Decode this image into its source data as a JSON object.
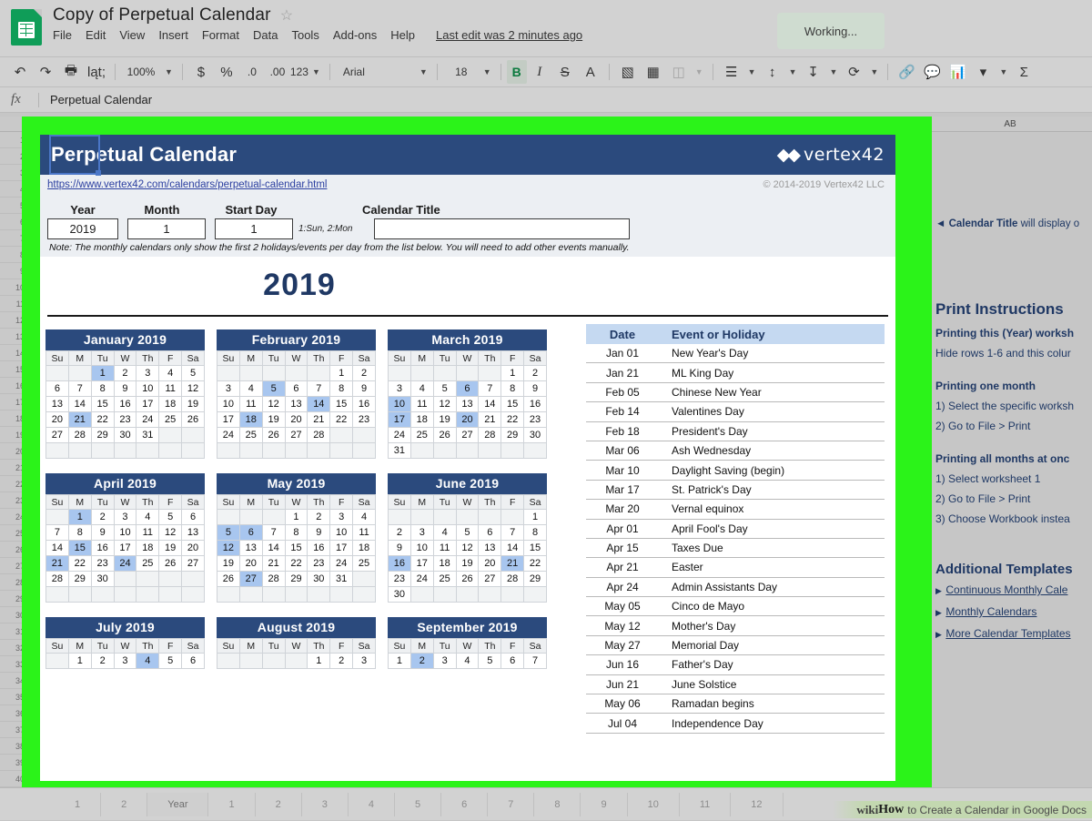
{
  "app": {
    "doc_title": "Copy of Perpetual Calendar",
    "star_icon": "star-outline-icon",
    "menu": [
      "File",
      "Edit",
      "View",
      "Insert",
      "Format",
      "Data",
      "Tools",
      "Add-ons",
      "Help"
    ],
    "last_edit": "Last edit was 2 minutes ago",
    "working_status": "Working..."
  },
  "toolbar": {
    "undo_icon": "undo-icon",
    "redo_icon": "redo-icon",
    "print_icon": "print-icon",
    "paint_format_icon": "paint-format-icon",
    "zoom": "100%",
    "currency": "$",
    "percent": "%",
    "decrease_decimal": ".0",
    "increase_decimal": ".00",
    "number_format": "123",
    "font": "Arial",
    "font_size": "18",
    "bold": "B",
    "italic": "I",
    "strikethrough": "S",
    "text_color": "A",
    "fill_color_icon": "fill-color-icon",
    "borders_icon": "borders-icon",
    "merge_icon": "merge-cells-icon",
    "halign_icon": "horizontal-align-icon",
    "valign_icon": "vertical-align-icon",
    "wrap_icon": "text-wrap-icon",
    "rotate_icon": "text-rotation-icon",
    "link_icon": "insert-link-icon",
    "comment_icon": "insert-comment-icon",
    "chart_icon": "insert-chart-icon",
    "filter_icon": "filter-icon",
    "functions_icon": "functions-sigma-icon"
  },
  "formula_bar": {
    "fx": "fx",
    "value": "Perpetual Calendar"
  },
  "grid": {
    "visible_column_header": "AB",
    "row_numbers": [
      "1",
      "2",
      "3",
      "4",
      "5",
      "6",
      "7",
      "8",
      "9",
      "10",
      "11",
      "12",
      "13",
      "14",
      "15",
      "16",
      "17",
      "18",
      "19",
      "20",
      "21",
      "22",
      "23",
      "24",
      "25",
      "26",
      "27",
      "28",
      "29",
      "30",
      "31",
      "32",
      "33",
      "34",
      "35",
      "36",
      "37",
      "38",
      "39",
      "40"
    ]
  },
  "sheet": {
    "title": "Perpetual Calendar",
    "logo_text": "vertex42",
    "url": "https://www.vertex42.com/calendars/perpetual-calendar.html",
    "copyright": "© 2014-2019 Vertex42 LLC",
    "fields": [
      {
        "label": "Year",
        "value": "2019"
      },
      {
        "label": "Month",
        "value": "1"
      },
      {
        "label": "Start Day",
        "value": "1"
      },
      {
        "label": "Calendar Title",
        "value": ""
      }
    ],
    "start_day_hint": "1:Sun, 2:Mon",
    "note": "Note: The monthly calendars only show the first 2 holidays/events per day from the list below. You will need to add other events manually.",
    "year_display": "2019"
  },
  "calendar": {
    "weekday_headers": [
      "Su",
      "M",
      "Tu",
      "W",
      "Th",
      "F",
      "Sa"
    ],
    "months": [
      {
        "name": "January 2019",
        "weeks": [
          [
            "",
            "",
            "1",
            "2",
            "3",
            "4",
            "5"
          ],
          [
            "6",
            "7",
            "8",
            "9",
            "10",
            "11",
            "12"
          ],
          [
            "13",
            "14",
            "15",
            "16",
            "17",
            "18",
            "19"
          ],
          [
            "20",
            "21",
            "22",
            "23",
            "24",
            "25",
            "26"
          ],
          [
            "27",
            "28",
            "29",
            "30",
            "31",
            "",
            ""
          ],
          [
            "",
            "",
            "",
            "",
            "",
            "",
            ""
          ]
        ],
        "highlights": [
          "1",
          "21"
        ]
      },
      {
        "name": "February 2019",
        "weeks": [
          [
            "",
            "",
            "",
            "",
            "",
            "1",
            "2"
          ],
          [
            "3",
            "4",
            "5",
            "6",
            "7",
            "8",
            "9"
          ],
          [
            "10",
            "11",
            "12",
            "13",
            "14",
            "15",
            "16"
          ],
          [
            "17",
            "18",
            "19",
            "20",
            "21",
            "22",
            "23"
          ],
          [
            "24",
            "25",
            "26",
            "27",
            "28",
            "",
            ""
          ],
          [
            "",
            "",
            "",
            "",
            "",
            "",
            ""
          ]
        ],
        "highlights": [
          "5",
          "14",
          "18"
        ]
      },
      {
        "name": "March 2019",
        "weeks": [
          [
            "",
            "",
            "",
            "",
            "",
            "1",
            "2"
          ],
          [
            "3",
            "4",
            "5",
            "6",
            "7",
            "8",
            "9"
          ],
          [
            "10",
            "11",
            "12",
            "13",
            "14",
            "15",
            "16"
          ],
          [
            "17",
            "18",
            "19",
            "20",
            "21",
            "22",
            "23"
          ],
          [
            "24",
            "25",
            "26",
            "27",
            "28",
            "29",
            "30"
          ],
          [
            "31",
            "",
            "",
            "",
            "",
            "",
            ""
          ]
        ],
        "highlights": [
          "6",
          "10",
          "17",
          "20"
        ]
      },
      {
        "name": "April 2019",
        "weeks": [
          [
            "",
            "1",
            "2",
            "3",
            "4",
            "5",
            "6"
          ],
          [
            "7",
            "8",
            "9",
            "10",
            "11",
            "12",
            "13"
          ],
          [
            "14",
            "15",
            "16",
            "17",
            "18",
            "19",
            "20"
          ],
          [
            "21",
            "22",
            "23",
            "24",
            "25",
            "26",
            "27"
          ],
          [
            "28",
            "29",
            "30",
            "",
            "",
            "",
            ""
          ],
          [
            "",
            "",
            "",
            "",
            "",
            "",
            ""
          ]
        ],
        "highlights": [
          "1",
          "15",
          "21",
          "24"
        ]
      },
      {
        "name": "May 2019",
        "weeks": [
          [
            "",
            "",
            "",
            "1",
            "2",
            "3",
            "4"
          ],
          [
            "5",
            "6",
            "7",
            "8",
            "9",
            "10",
            "11"
          ],
          [
            "12",
            "13",
            "14",
            "15",
            "16",
            "17",
            "18"
          ],
          [
            "19",
            "20",
            "21",
            "22",
            "23",
            "24",
            "25"
          ],
          [
            "26",
            "27",
            "28",
            "29",
            "30",
            "31",
            ""
          ],
          [
            "",
            "",
            "",
            "",
            "",
            "",
            ""
          ]
        ],
        "highlights": [
          "5",
          "6",
          "12",
          "27"
        ]
      },
      {
        "name": "June 2019",
        "weeks": [
          [
            "",
            "",
            "",
            "",
            "",
            "",
            "1"
          ],
          [
            "2",
            "3",
            "4",
            "5",
            "6",
            "7",
            "8"
          ],
          [
            "9",
            "10",
            "11",
            "12",
            "13",
            "14",
            "15"
          ],
          [
            "16",
            "17",
            "18",
            "19",
            "20",
            "21",
            "22"
          ],
          [
            "23",
            "24",
            "25",
            "26",
            "27",
            "28",
            "29"
          ],
          [
            "30",
            "",
            "",
            "",
            "",
            "",
            ""
          ]
        ],
        "highlights": [
          "16",
          "21"
        ]
      },
      {
        "name": "July 2019",
        "weeks": [
          [
            "",
            "1",
            "2",
            "3",
            "4",
            "5",
            "6"
          ]
        ],
        "highlights": [
          "4"
        ]
      },
      {
        "name": "August 2019",
        "weeks": [
          [
            "",
            "",
            "",
            "",
            "1",
            "2",
            "3"
          ]
        ],
        "highlights": []
      },
      {
        "name": "September 2019",
        "weeks": [
          [
            "1",
            "2",
            "3",
            "4",
            "5",
            "6",
            "7"
          ]
        ],
        "highlights": [
          "2"
        ]
      }
    ]
  },
  "events": {
    "headers": [
      "Date",
      "Event or Holiday"
    ],
    "rows": [
      [
        "Jan 01",
        "New Year's Day"
      ],
      [
        "Jan 21",
        "ML King Day"
      ],
      [
        "Feb 05",
        "Chinese New Year"
      ],
      [
        "Feb 14",
        "Valentines Day"
      ],
      [
        "Feb 18",
        "President's Day"
      ],
      [
        "Mar 06",
        "Ash Wednesday"
      ],
      [
        "Mar 10",
        "Daylight Saving (begin)"
      ],
      [
        "Mar 17",
        "St. Patrick's Day"
      ],
      [
        "Mar 20",
        "Vernal equinox"
      ],
      [
        "Apr 01",
        "April Fool's Day"
      ],
      [
        "Apr 15",
        "Taxes Due"
      ],
      [
        "Apr 21",
        "Easter"
      ],
      [
        "Apr 24",
        "Admin Assistants Day"
      ],
      [
        "May 05",
        "Cinco de Mayo"
      ],
      [
        "May 12",
        "Mother's Day"
      ],
      [
        "May 27",
        "Memorial Day"
      ],
      [
        "Jun 16",
        "Father's Day"
      ],
      [
        "Jun 21",
        "June Solstice"
      ],
      [
        "May 06",
        "Ramadan begins"
      ],
      [
        "Jul 04",
        "Independence Day"
      ]
    ]
  },
  "instructions": {
    "title_note_prefix": "◄ ",
    "title_note_bold": "Calendar Title",
    "title_note_rest": " will display o",
    "heading": "Print Instructions",
    "sub1": "Printing this (Year) worksh",
    "sub1_text": "Hide rows 1-6 and this colur",
    "sub2": "Printing one month",
    "sub2_l1": "1) Select the specific worksh",
    "sub2_l2": "2) Go to File > Print",
    "sub3": "Printing all months at onc",
    "sub3_l1": "1) Select worksheet 1",
    "sub3_l2": "2) Go to File > Print",
    "sub3_l3": "3) Choose Workbook instea",
    "templates_heading": "Additional Templates",
    "templates": [
      "Continuous Monthly Cale",
      "Monthly Calendars",
      "More Calendar Templates"
    ]
  },
  "bottom": {
    "tabs": [
      "1",
      "2",
      "Year",
      "1",
      "2",
      "3",
      "4",
      "5",
      "6",
      "7",
      "8",
      "9",
      "10",
      "11",
      "12"
    ],
    "active_tab": "Year",
    "watermark_wiki": "wiki",
    "watermark_how": "How",
    "watermark_rest": "to Create a Calendar in Google Docs"
  }
}
